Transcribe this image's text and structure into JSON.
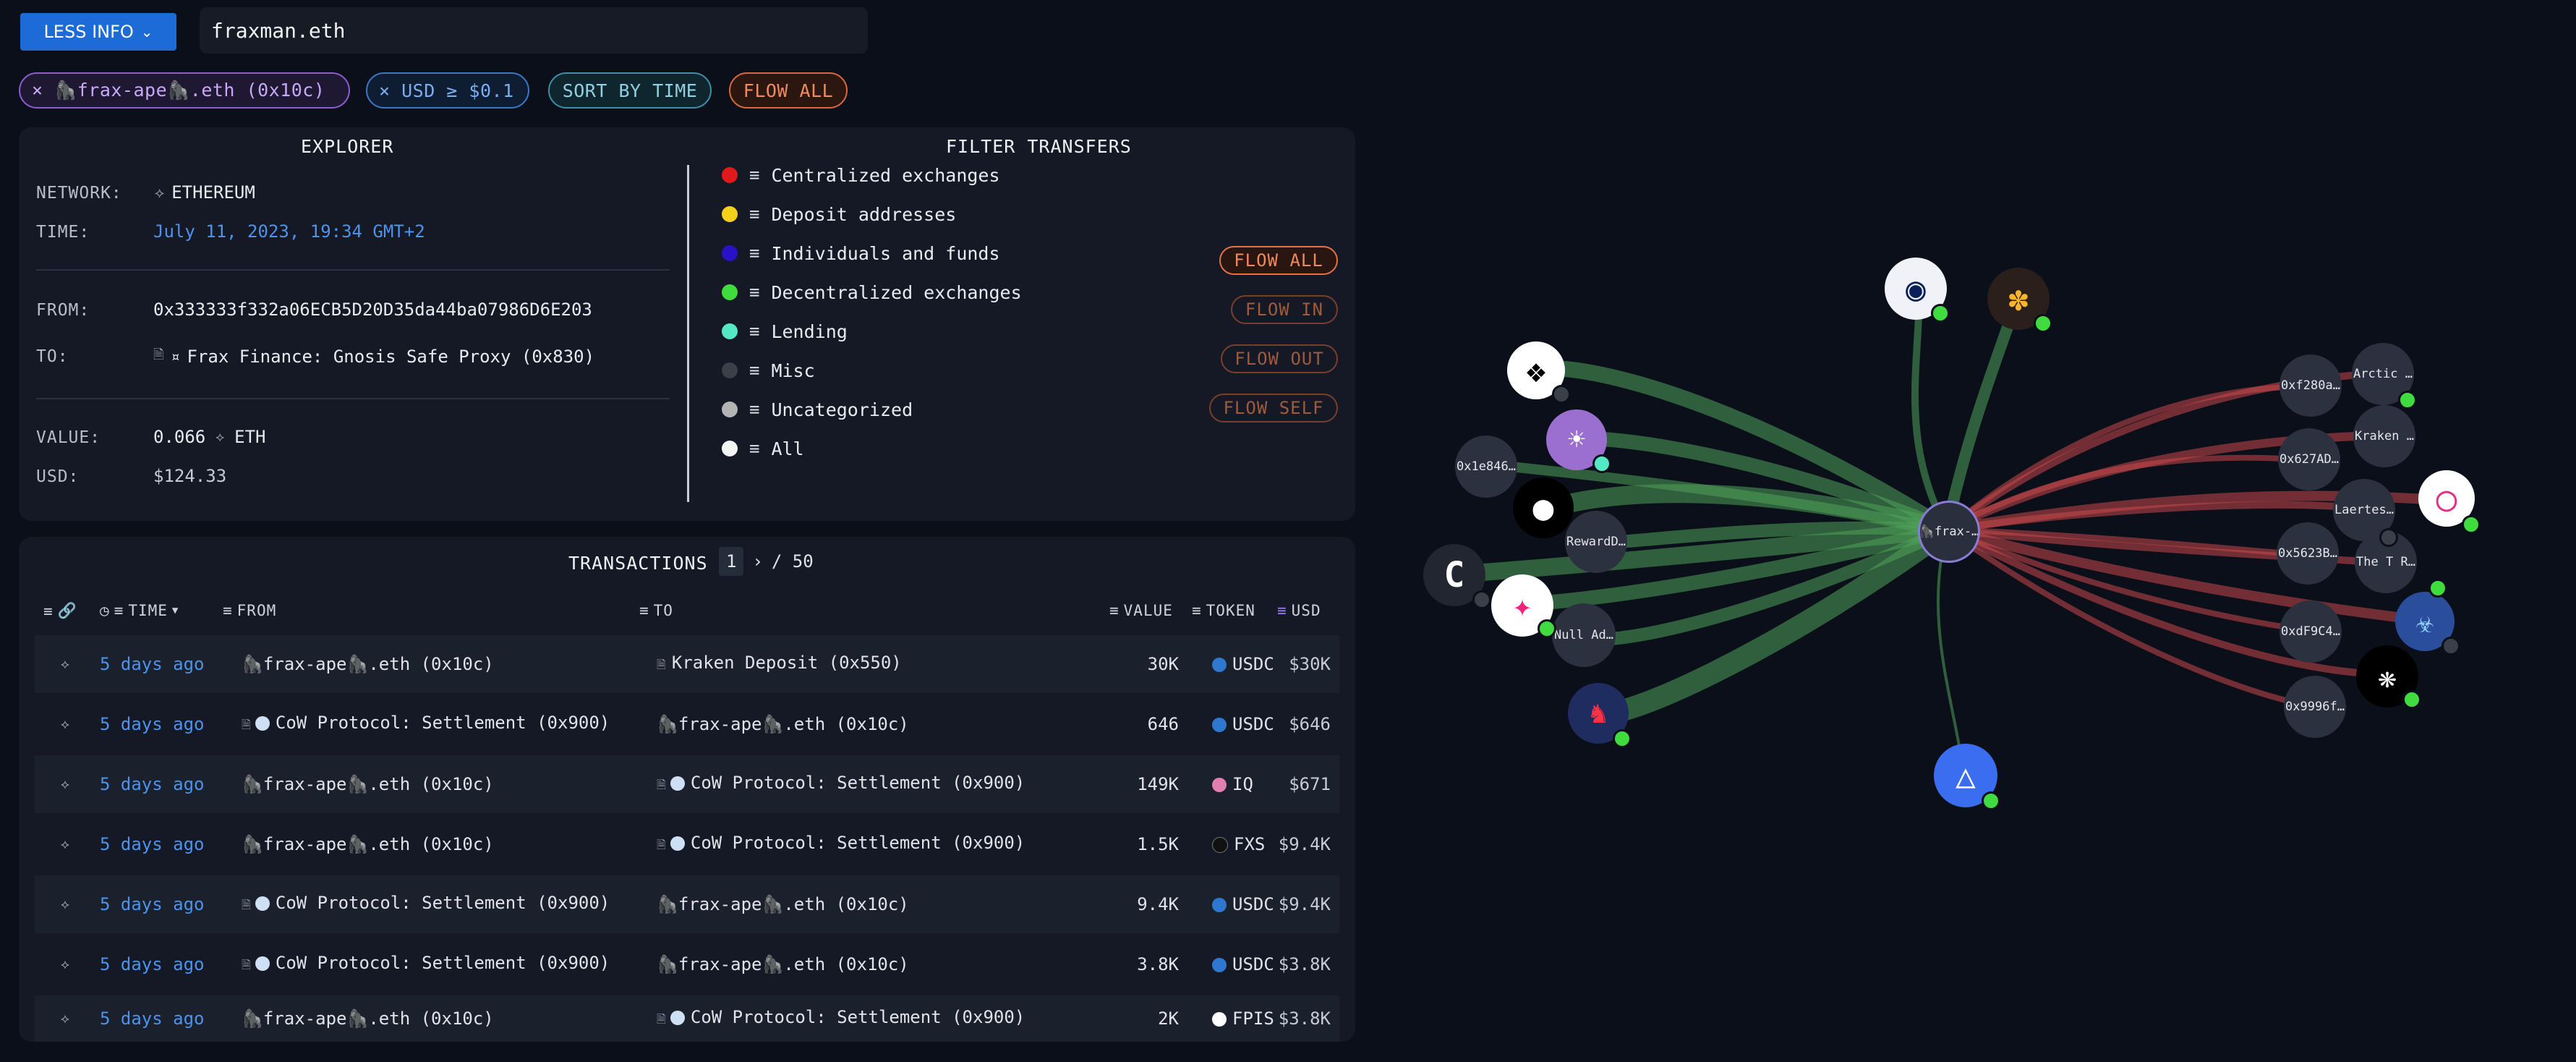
{
  "toolbar": {
    "less_info_label": "LESS INFO",
    "search_value": "fraxman.eth"
  },
  "chips": {
    "address": "× 🦍‍frax-ape🦍.eth (0x10c)",
    "usd": "× USD ≥ $0.1",
    "sort": "SORT BY TIME",
    "flow": "FLOW ALL"
  },
  "explorer": {
    "title": "EXPLORER",
    "network_label": "NETWORK:",
    "network_value": "ETHEREUM",
    "time_label": "TIME:",
    "time_value": "July 11, 2023, 19:34 GMT+2",
    "from_label": "FROM:",
    "from_value": "0x333333f332a06ECB5D20D35da44ba07986D6E203",
    "to_label": "TO:",
    "to_value": "Frax Finance: Gnosis Safe Proxy (0x830)",
    "value_label": "VALUE:",
    "value_amount": "0.066",
    "value_unit": "ETH",
    "usd_label": "USD:",
    "usd_value": "$124.33"
  },
  "filters": {
    "title": "FILTER TRANSFERS",
    "items": [
      {
        "label": "Centralized exchanges",
        "color": "#e01a1a"
      },
      {
        "label": "Deposit addresses",
        "color": "#f3d11b"
      },
      {
        "label": "Individuals and funds",
        "color": "#2a10c7"
      },
      {
        "label": "Decentralized exchanges",
        "color": "#3fdb3f"
      },
      {
        "label": "Lending",
        "color": "#55e8c4"
      },
      {
        "label": "Misc",
        "color": "#3b3f47"
      },
      {
        "label": "Uncategorized",
        "color": "#b3b3b3"
      },
      {
        "label": "All",
        "color": "#f4f4f4"
      }
    ],
    "flow_buttons": [
      "FLOW ALL",
      "FLOW IN",
      "FLOW OUT",
      "FLOW SELF"
    ]
  },
  "transactions": {
    "title": "TRANSACTIONS",
    "page": "1",
    "total_pages": "/ 50",
    "columns": {
      "time": "TIME",
      "from": "FROM",
      "to": "TO",
      "value": "VALUE",
      "token": "TOKEN",
      "usd": "USD"
    },
    "rows": [
      {
        "time": "5 days ago",
        "from": "🦍frax-ape🦍.eth (0x10c)",
        "to": "Kraken Deposit (0x550)",
        "value": "30K",
        "token": "USDC",
        "usd": "$30K"
      },
      {
        "time": "5 days ago",
        "from": "CoW Protocol: Settlement (0x900)",
        "to": "🦍frax-ape🦍.eth (0x10c)",
        "value": "646",
        "token": "USDC",
        "usd": "$646"
      },
      {
        "time": "5 days ago",
        "from": "🦍frax-ape🦍.eth (0x10c)",
        "to": "CoW Protocol: Settlement (0x900)",
        "value": "149K",
        "token": "IQ",
        "usd": "$671"
      },
      {
        "time": "5 days ago",
        "from": "🦍frax-ape🦍.eth (0x10c)",
        "to": "CoW Protocol: Settlement (0x900)",
        "value": "1.5K",
        "token": "FXS",
        "usd": "$9.4K"
      },
      {
        "time": "5 days ago",
        "from": "CoW Protocol: Settlement (0x900)",
        "to": "🦍frax-ape🦍.eth (0x10c)",
        "value": "9.4K",
        "token": "USDC",
        "usd": "$9.4K"
      },
      {
        "time": "5 days ago",
        "from": "CoW Protocol: Settlement (0x900)",
        "to": "🦍frax-ape🦍.eth (0x10c)",
        "value": "3.8K",
        "token": "USDC",
        "usd": "$3.8K"
      },
      {
        "time": "5 days ago",
        "from": "🦍frax-ape🦍.eth (0x10c)",
        "to": "CoW Protocol: Settlement (0x900)",
        "value": "2K",
        "token": "FPIS",
        "usd": "$3.8K"
      }
    ]
  },
  "graph": {
    "center_label": "🦍frax-…",
    "labels": {
      "n_0x1e84": "0x1e846…",
      "n_reward": "RewardD…",
      "n_null": "Null Ad…",
      "n_0xf280": "0xf280a…",
      "n_arctic": "Arctic …",
      "n_0x627": "0x627AD…",
      "n_kraken": "Kraken …",
      "n_laertes": "Laertes…",
      "n_0x5623": "0x5623B…",
      "n_thetr": "The T R…",
      "n_0xdf9": "0xdF9C4…",
      "n_0x9996": "0x9996f…"
    },
    "colors": {
      "inflow": "#4ea35a",
      "outflow": "#c9494a"
    }
  }
}
